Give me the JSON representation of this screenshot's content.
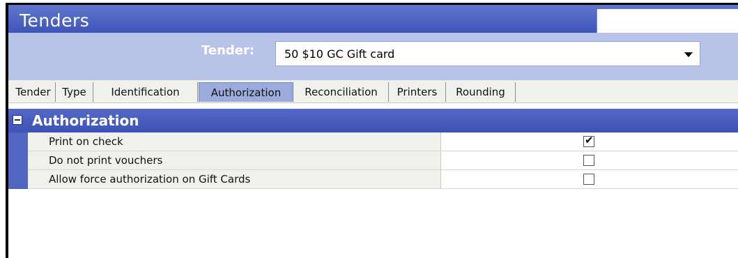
{
  "window": {
    "title": "Tenders"
  },
  "tender_selector": {
    "label": "Tender:",
    "selected_value": "50 $10 GC Gift card"
  },
  "tabs": [
    {
      "label": "Tender",
      "active": false
    },
    {
      "label": "Type",
      "active": false
    },
    {
      "label": "Identification",
      "active": false
    },
    {
      "label": "Authorization",
      "active": true
    },
    {
      "label": "Reconciliation",
      "active": false
    },
    {
      "label": "Printers",
      "active": false
    },
    {
      "label": "Rounding",
      "active": false
    }
  ],
  "section": {
    "title": "Authorization",
    "expanded": true,
    "rows": [
      {
        "label": "Print on check",
        "checked": true
      },
      {
        "label": "Do not print vouchers",
        "checked": false
      },
      {
        "label": "Allow force authorization on Gift Cards",
        "checked": false
      }
    ]
  },
  "colors": {
    "title_bar": "#3e55ba",
    "selector_band": "#b9c3ea",
    "section_header": "#4a5fc0",
    "active_tab": "#9bacdc",
    "row_label_bg": "#f1f1ec"
  }
}
